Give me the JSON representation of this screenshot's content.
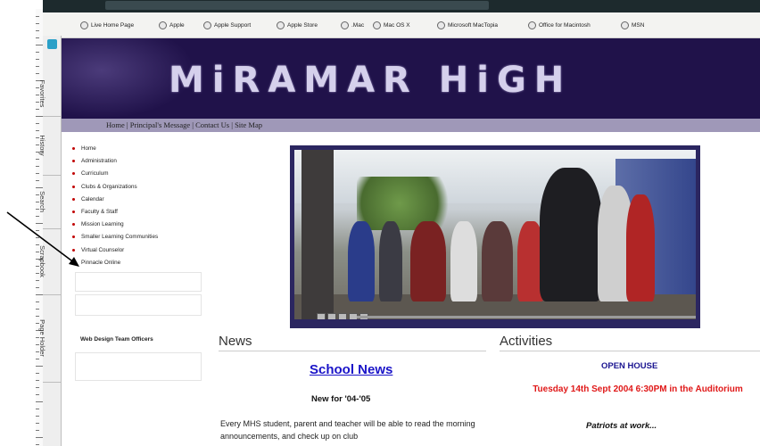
{
  "favorites": [
    "Live Home Page",
    "Apple",
    "Apple Support",
    "Apple Store",
    ".Mac",
    "Mac OS X",
    "Microsoft MacTopia",
    "Office for Macintosh",
    "MSN"
  ],
  "side_tabs": [
    "Favorites",
    "History",
    "Search",
    "Scrapbook",
    "Page Holder"
  ],
  "banner": {
    "title": "MiRAMAR HiGH"
  },
  "top_nav": [
    "Home",
    "Principal's Message",
    "Contact Us",
    "Site Map"
  ],
  "left_nav": [
    "Home",
    "Administration",
    "Curriculum",
    "Clubs & Organizations",
    "Calendar",
    "Faculty & Staff",
    "Mission Learning",
    "Smaller Learning Communities",
    "Virtual Counselor",
    "Pinnacle Online"
  ],
  "web_design": "Web Design Team Officers",
  "news": {
    "heading": "News",
    "link": "School News",
    "subheading": "New for '04-'05",
    "body": "Every MHS student, parent and teacher will be able to read the morning announcements, and check up on club"
  },
  "activities": {
    "heading": "Activities",
    "event_title": "OPEN HOUSE",
    "event_detail": "Tuesday 14th  Sept 2004 6:30PM in the Auditorium",
    "caption": "Patriots at work..."
  },
  "colors": {
    "banner": "#20124a",
    "navbar": "#9f98b8",
    "link": "#1a14c8",
    "alert": "#e01818"
  }
}
